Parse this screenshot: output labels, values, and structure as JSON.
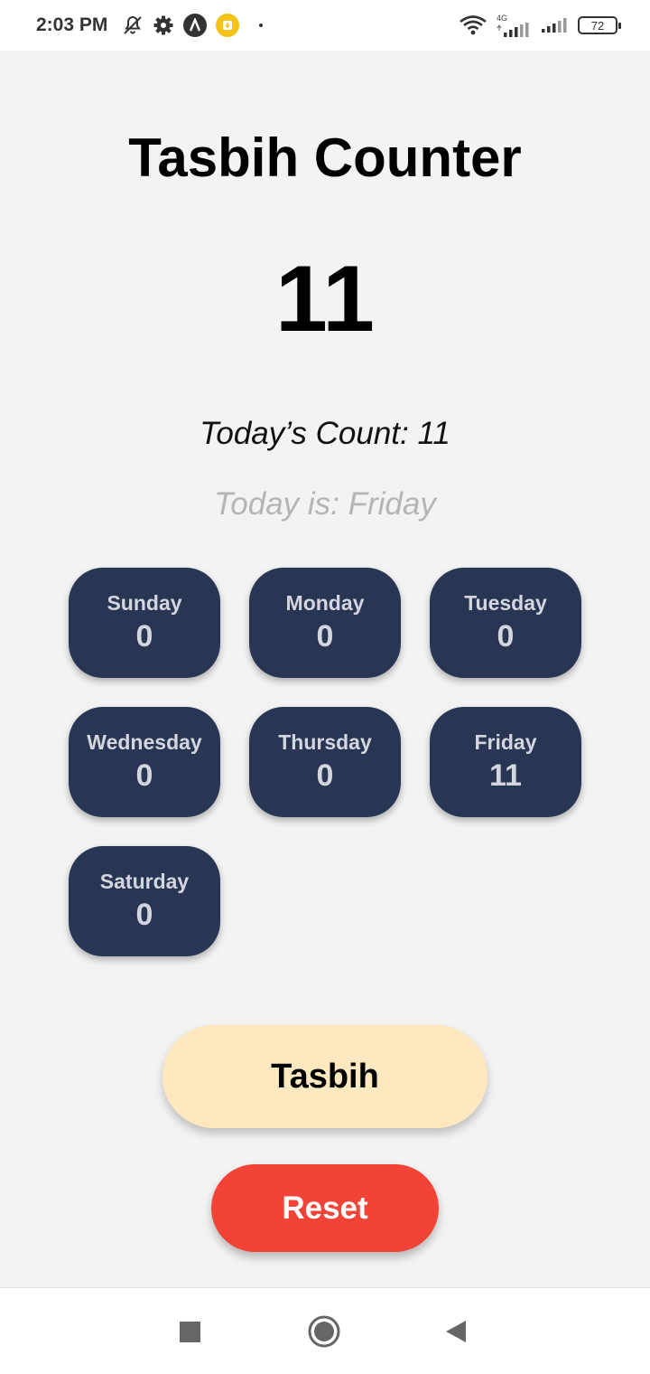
{
  "status_bar": {
    "time": "2:03 PM",
    "network_label": "4G",
    "battery": "72",
    "icons": [
      "bell-off-icon",
      "gear-icon",
      "app-a-icon",
      "download-icon",
      "wifi-icon",
      "signal-icon",
      "battery-icon"
    ]
  },
  "app": {
    "title": "Tasbih Counter",
    "count": "11",
    "today_count": "Today’s Count: 11",
    "today_is": "Today is: Friday"
  },
  "days": [
    {
      "name": "Sunday",
      "value": "0"
    },
    {
      "name": "Monday",
      "value": "0"
    },
    {
      "name": "Tuesday",
      "value": "0"
    },
    {
      "name": "Wednesday",
      "value": "0"
    },
    {
      "name": "Thursday",
      "value": "0"
    },
    {
      "name": "Friday",
      "value": "11"
    },
    {
      "name": "Saturday",
      "value": "0"
    }
  ],
  "buttons": {
    "tasbih": "Tasbih",
    "reset": "Reset"
  },
  "colors": {
    "background": "#f3f3f3",
    "card": "#283654",
    "card_text": "#d3d6de",
    "tasbih_button": "#fde8c0",
    "reset_button": "#f14336",
    "muted_text": "#b5b5b5"
  },
  "nav_bar": {
    "icons": [
      "recents-square-icon",
      "home-circle-icon",
      "back-triangle-icon"
    ]
  }
}
